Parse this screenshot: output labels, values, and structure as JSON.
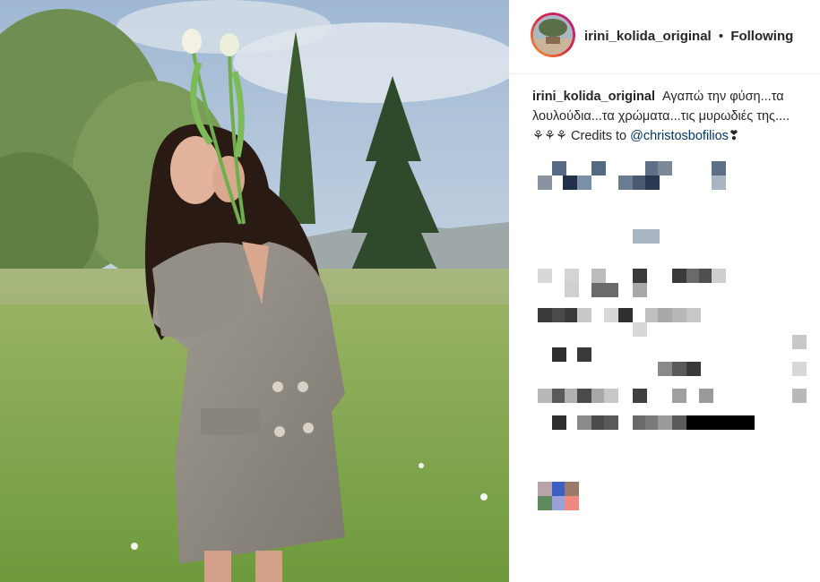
{
  "post": {
    "username": "irini_kolida_original",
    "separator": "•",
    "follow_label": "Following",
    "caption_user": "irini_kolida_original",
    "caption_text": "Αγαπώ την φύση...τα λουλούδια...τα χρώματα...τις μυρωδιές της.... ⚘⚘⚘ Credits to",
    "mention": "@christosbofilios",
    "heart": "❣"
  },
  "icons": [
    "profile-avatar",
    "tulip-icon"
  ],
  "colors": {
    "text": "#262626",
    "mention": "#00376b",
    "ring": "#dc2743"
  }
}
